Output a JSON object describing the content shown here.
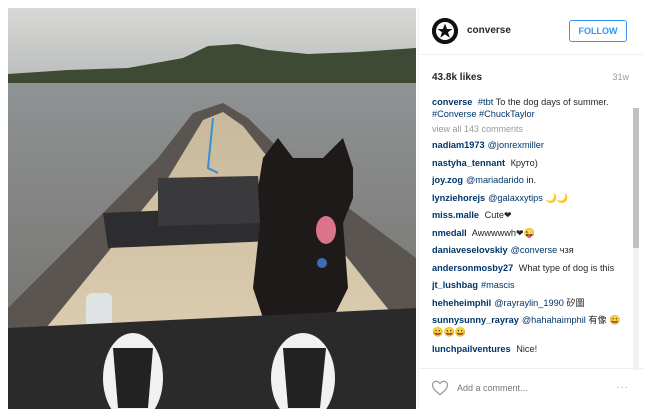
{
  "post": {
    "username": "converse",
    "follow_label": "FOLLOW",
    "likes": "43.8k likes",
    "time": "31w",
    "caption_text": "To the dog days of summer.",
    "caption_tags_pre": "#tbt",
    "caption_tags_post": "#Converse #ChuckTaylor",
    "view_all": "view all 143 comments",
    "comments": [
      {
        "user": "nadiam1973",
        "text": "",
        "link": "@jonrexmiller"
      },
      {
        "user": "nastyha_tennant",
        "text": "Круто)",
        "link": ""
      },
      {
        "user": "joy.zog",
        "text": "in.",
        "link": "@mariadarido"
      },
      {
        "user": "lynziehorejs",
        "text": "🌙🌙",
        "link": "@galaxxytips"
      },
      {
        "user": "miss.malle",
        "text": "Cute❤",
        "link": ""
      },
      {
        "user": "nmedall",
        "text": "Awwwwwh❤😜",
        "link": ""
      },
      {
        "user": "daniaveselovskiy",
        "text": "чзя",
        "link": "@converse"
      },
      {
        "user": "andersonmosby27",
        "text": "What type of dog is this",
        "link": ""
      },
      {
        "user": "jt_lushbag",
        "text": "",
        "link": "#mascis"
      },
      {
        "user": "heheheimphil",
        "text": "矽圖",
        "link": "@rayraylin_1990"
      },
      {
        "user": "sunnysunny_rayray",
        "text": "有像 😀😀😀😀",
        "link": "@hahahaimphil"
      },
      {
        "user": "lunchpailventures",
        "text": "Nice!",
        "link": ""
      }
    ],
    "add_comment_placeholder": "Add a comment...",
    "more_label": "···"
  },
  "icons": {
    "avatar": "converse-star-logo",
    "like": "heart-icon",
    "more": "ellipsis-icon"
  }
}
